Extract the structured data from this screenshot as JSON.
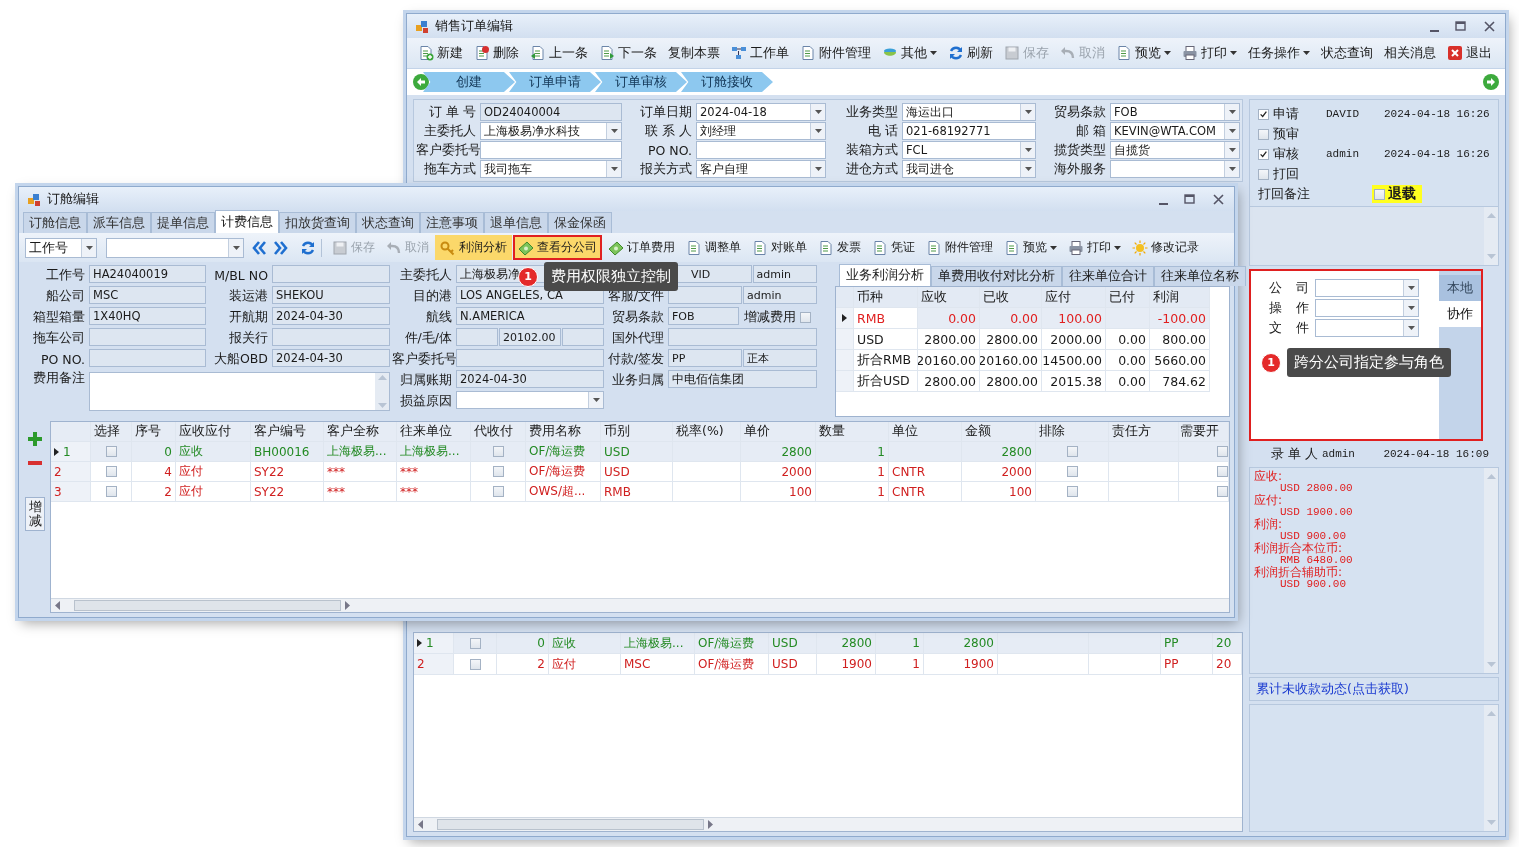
{
  "back_window": {
    "title": "销售订单编辑",
    "toolbar": [
      {
        "label": "新建",
        "disabled": false,
        "dropdown": false
      },
      {
        "label": "删除",
        "disabled": false,
        "dropdown": false
      },
      {
        "label": "上一条",
        "disabled": false,
        "dropdown": false
      },
      {
        "label": "下一条",
        "disabled": false,
        "dropdown": false
      },
      {
        "label": "复制本票",
        "disabled": false,
        "dropdown": false
      },
      {
        "label": "工作单",
        "disabled": false,
        "dropdown": false
      },
      {
        "label": "附件管理",
        "disabled": false,
        "dropdown": false
      },
      {
        "label": "其他",
        "disabled": false,
        "dropdown": true
      },
      {
        "label": "刷新",
        "disabled": false,
        "dropdown": false
      },
      {
        "label": "保存",
        "disabled": true,
        "dropdown": false
      },
      {
        "label": "取消",
        "disabled": true,
        "dropdown": false
      },
      {
        "label": "预览",
        "disabled": false,
        "dropdown": true
      },
      {
        "label": "打印",
        "disabled": false,
        "dropdown": true
      },
      {
        "label": "任务操作",
        "disabled": false,
        "dropdown": true
      },
      {
        "label": "状态查询",
        "disabled": false,
        "dropdown": false
      },
      {
        "label": "相关消息",
        "disabled": false,
        "dropdown": false
      },
      {
        "label": "退出",
        "disabled": false,
        "dropdown": false
      }
    ],
    "steps": [
      "创建",
      "订单申请",
      "订单审核",
      "订舱接收"
    ],
    "form": [
      {
        "label": "订 单 号",
        "value": "OD24040004",
        "kind": "readonly"
      },
      {
        "label": "订单日期",
        "value": "2024-04-18",
        "kind": "combo"
      },
      {
        "label": "业务类型",
        "value": "海运出口",
        "kind": "combo"
      },
      {
        "label": "贸易条款",
        "value": "FOB",
        "kind": "combo"
      },
      {
        "label": "主委托人",
        "value": "上海极易净水科技",
        "kind": "combo"
      },
      {
        "label": "联 系 人",
        "value": "刘经理",
        "kind": "combo"
      },
      {
        "label": "电 话",
        "value": "021-68192771",
        "kind": "text"
      },
      {
        "label": "邮 箱",
        "value": "KEVIN@WTA.COM",
        "kind": "combo"
      },
      {
        "label": "客户委托号",
        "kind": "text"
      },
      {
        "label": "PO NO.",
        "kind": "text"
      },
      {
        "label": "装箱方式",
        "value": "FCL",
        "kind": "combo"
      },
      {
        "label": "揽货类型",
        "value": "自揽货",
        "kind": "combo"
      },
      {
        "label": "拖车方式",
        "value": "我司拖车",
        "kind": "combo"
      },
      {
        "label": "报关方式",
        "value": "客户自理",
        "kind": "combo"
      },
      {
        "label": "进仓方式",
        "value": "我司进仓",
        "kind": "combo"
      },
      {
        "label": "海外服务",
        "kind": "combo"
      }
    ],
    "fee_rows": [
      {
        "row_number": "1",
        "current": true,
        "kind": "receivable",
        "checked": false,
        "seq": "0",
        "direction": "应收",
        "party": "上海极易...",
        "fee_name": "OF/海运费",
        "currency": "USD",
        "unit_price": "2800",
        "quantity": "1",
        "amount": "2800",
        "payment": "PP",
        "column_14": "20"
      },
      {
        "row_number": "2",
        "current": false,
        "kind": "payable",
        "checked": false,
        "seq": "2",
        "direction": "应付",
        "party": "MSC",
        "fee_name": "OF/海运费",
        "currency": "USD",
        "unit_price": "1900",
        "quantity": "1",
        "amount": "1900",
        "payment": "PP",
        "column_14": "20"
      }
    ],
    "approvals": [
      {
        "label": "申请",
        "checked": true,
        "user": "DAVID",
        "time": "2024-04-18 16:26"
      },
      {
        "label": "预审",
        "checked": false
      },
      {
        "label": "审核",
        "checked": true,
        "user": "admin",
        "time": "2024-04-18 16:26"
      },
      {
        "label": "打回",
        "checked": false
      }
    ],
    "return_note_label": "打回备注",
    "withdraw": {
      "label": "退载",
      "checked": false
    },
    "roles": {
      "annotated": true,
      "fields": [
        "公 司",
        "操 作",
        "文 件"
      ],
      "tabs": [
        {
          "label": "本地",
          "selected": false
        },
        {
          "label": "协作",
          "selected": true
        }
      ],
      "callout": {
        "number": "1",
        "text": "跨分公司指定参与角色"
      }
    },
    "entered_by": {
      "label": "录 单 人",
      "user": "admin",
      "time": "2024-04-18 16:09"
    },
    "summary": [
      {
        "kind": "heading",
        "text": "应收:"
      },
      {
        "kind": "amount",
        "text": "USD  2800.00"
      },
      {
        "kind": "heading",
        "text": "应付:"
      },
      {
        "kind": "amount",
        "text": "USD  1900.00"
      },
      {
        "kind": "heading",
        "text": "利润:"
      },
      {
        "kind": "amount",
        "text": "USD  900.00"
      },
      {
        "kind": "heading",
        "text": "利润折合本位币:"
      },
      {
        "kind": "amount",
        "text": "RMB  6480.00"
      },
      {
        "kind": "heading",
        "text": "利润折合辅助币:"
      },
      {
        "kind": "amount",
        "text": "USD  900.00"
      }
    ],
    "link": "累计未收款动态(点击获取)"
  },
  "front_window": {
    "title": "订舱编辑",
    "tabs": [
      {
        "label": "订舱信息",
        "selected": false
      },
      {
        "label": "派车信息",
        "selected": false
      },
      {
        "label": "提单信息",
        "selected": false
      },
      {
        "label": "计费信息",
        "selected": true
      },
      {
        "label": "扣放货查询",
        "selected": false
      },
      {
        "label": "状态查询",
        "selected": false
      },
      {
        "label": "注意事项",
        "selected": false
      },
      {
        "label": "退单信息",
        "selected": false
      },
      {
        "label": "保金保函",
        "selected": false
      }
    ],
    "search_field": "工作号",
    "toolbar": [
      {
        "label": "保存",
        "disabled": true,
        "dropdown": false,
        "highlighted": false,
        "annotated": false
      },
      {
        "label": "取消",
        "disabled": true,
        "dropdown": false,
        "highlighted": false,
        "annotated": false
      },
      {
        "label": "利润分析",
        "disabled": false,
        "dropdown": false,
        "highlighted": true,
        "annotated": false
      },
      {
        "label": "查看分公司",
        "disabled": false,
        "dropdown": false,
        "highlighted": true,
        "annotated": true
      },
      {
        "label": "订单费用",
        "disabled": false,
        "dropdown": false,
        "highlighted": false,
        "annotated": false
      },
      {
        "label": "调整单",
        "disabled": false,
        "dropdown": false,
        "highlighted": false,
        "annotated": false
      },
      {
        "label": "对账单",
        "disabled": false,
        "dropdown": false,
        "highlighted": false,
        "annotated": false
      },
      {
        "label": "发票",
        "disabled": false,
        "dropdown": false,
        "highlighted": false,
        "annotated": false
      },
      {
        "label": "凭证",
        "disabled": false,
        "dropdown": false,
        "highlighted": false,
        "annotated": false
      },
      {
        "label": "附件管理",
        "disabled": false,
        "dropdown": false,
        "highlighted": false,
        "annotated": false
      },
      {
        "label": "预览",
        "disabled": false,
        "dropdown": true,
        "highlighted": false,
        "annotated": false
      },
      {
        "label": "打印",
        "disabled": false,
        "dropdown": true,
        "highlighted": false,
        "annotated": false
      },
      {
        "label": "修改记录",
        "disabled": false,
        "dropdown": false,
        "highlighted": false,
        "annotated": false
      }
    ],
    "callout": {
      "number": "1",
      "text": "费用权限独立控制"
    },
    "form_columns": [
      [
        {
          "label": "工作号",
          "value": "HA24040019",
          "kind": "readonly"
        },
        {
          "label": "船公司",
          "value": "MSC",
          "kind": "readonly"
        },
        {
          "label": "箱型箱量",
          "value": "1X40HQ",
          "kind": "readonly"
        },
        {
          "label": "拖车公司",
          "kind": "readonly"
        },
        {
          "label": "PO NO.",
          "kind": "readonly"
        },
        {
          "label": "费用备注",
          "kind": "memo"
        }
      ],
      [
        {
          "label": "M/BL NO",
          "kind": "readonly"
        },
        {
          "label": "装运港",
          "value": "SHEKOU",
          "kind": "readonly"
        },
        {
          "label": "开航期",
          "value": "2024-04-30",
          "kind": "readonly"
        },
        {
          "label": "报关行",
          "kind": "readonly"
        },
        {
          "label": "大船OBD",
          "value": "2024-04-30",
          "kind": "readonly"
        }
      ],
      [
        {
          "label": "主委托人",
          "value": "上海极易净",
          "kind": "readonly"
        },
        {
          "label": "目的港",
          "value": "LOS ANGELES, CA",
          "kind": "readonly"
        },
        {
          "label": "航线",
          "value": "N.AMERICA",
          "kind": "readonly"
        },
        {
          "label": "件/毛/体",
          "kind": "split",
          "parts": [
            {
              "kind": "text"
            },
            {
              "kind": "text",
              "value": "20102.00"
            },
            {
              "kind": "text"
            }
          ]
        },
        {
          "label": "客户委托号",
          "kind": "readonly"
        },
        {
          "label": "归属账期",
          "value": "2024-04-30",
          "kind": "readonly"
        },
        {
          "label": "损益原因",
          "kind": "combo"
        }
      ],
      [
        {
          "kind": "split",
          "parts": [
            {
              "kind": "text",
              "value": "VID"
            },
            {
              "kind": "text",
              "value": "admin"
            }
          ]
        },
        {
          "label": "客服/文件",
          "kind": "split",
          "parts": [
            {
              "kind": "text"
            },
            {
              "kind": "text",
              "value": "admin"
            }
          ]
        },
        {
          "label": "贸易条款",
          "kind": "split",
          "parts": [
            {
              "kind": "text",
              "value": "FOB"
            },
            {
              "kind": "check",
              "label": "增减费用",
              "checked": false
            }
          ]
        },
        {
          "label": "国外代理",
          "kind": "readonly"
        },
        {
          "label": "付款/签发",
          "kind": "split",
          "parts": [
            {
              "kind": "text",
              "value": "PP"
            },
            {
              "kind": "text",
              "value": "正本"
            }
          ]
        },
        {
          "label": "业务归属",
          "value": "中电佰信集团",
          "kind": "readonly"
        }
      ]
    ],
    "analysis": {
      "tabs": [
        {
          "label": "业务利润分析",
          "selected": true
        },
        {
          "label": "单费用收付对比分析",
          "selected": false
        },
        {
          "label": "往来单位合计",
          "selected": false
        },
        {
          "label": "往来单位名称",
          "selected": false
        }
      ],
      "columns": [
        "币种",
        "应收",
        "已收",
        "应付",
        "已付",
        "利润"
      ],
      "rows": [
        {
          "current": true,
          "alert": true,
          "currency": "RMB",
          "receivable": "0.00",
          "received": "0.00",
          "payable": "100.00",
          "profit": "-100.00"
        },
        {
          "current": false,
          "alert": false,
          "currency": "USD",
          "receivable": "2800.00",
          "received": "2800.00",
          "payable": "2000.00",
          "paid": "0.00",
          "profit": "800.00"
        },
        {
          "current": false,
          "alert": false,
          "currency": "折合RMB",
          "receivable": "20160.00",
          "received": "20160.00",
          "payable": "14500.00",
          "paid": "0.00",
          "profit": "5660.00"
        },
        {
          "current": false,
          "alert": false,
          "currency": "折合USD",
          "receivable": "2800.00",
          "received": "2800.00",
          "payable": "2015.38",
          "paid": "0.00",
          "profit": "784.62"
        }
      ]
    },
    "side_button": "增减",
    "fees": {
      "columns": [
        "选择",
        "序号",
        "应收应付",
        "客户编号",
        "客户全称",
        "往来单位",
        "代收付",
        "费用名称",
        "币别",
        "税率(%)",
        "单价",
        "数量",
        "单位",
        "金额",
        "排除",
        "责任方",
        "需要开"
      ],
      "rows": [
        {
          "row_number": "1",
          "current": true,
          "kind": "receivable",
          "checked": false,
          "seq": "0",
          "direction": "应收",
          "customer_code": "BH00016",
          "customer_name": "上海极易...",
          "counterparty": "上海极易...",
          "collect": false,
          "fee_name": "OF/海运费",
          "currency": "USD",
          "unit_price": "2800",
          "quantity": "1",
          "amount": "2800",
          "excluded": false,
          "invoice": false
        },
        {
          "row_number": "2",
          "current": false,
          "kind": "payable",
          "checked": false,
          "seq": "4",
          "direction": "应付",
          "customer_code": "SY22",
          "customer_name": "***",
          "counterparty": "***",
          "collect": false,
          "fee_name": "OF/海运费",
          "currency": "USD",
          "unit_price": "2000",
          "quantity": "1",
          "unit": "CNTR",
          "amount": "2000",
          "excluded": false,
          "invoice": false
        },
        {
          "row_number": "3",
          "current": false,
          "kind": "payable",
          "checked": false,
          "seq": "2",
          "direction": "应付",
          "customer_code": "SY22",
          "customer_name": "***",
          "counterparty": "***",
          "collect": false,
          "fee_name": "OWS/超...",
          "currency": "RMB",
          "unit_price": "100",
          "quantity": "1",
          "unit": "CNTR",
          "amount": "100",
          "excluded": false,
          "invoice": false
        }
      ]
    }
  }
}
